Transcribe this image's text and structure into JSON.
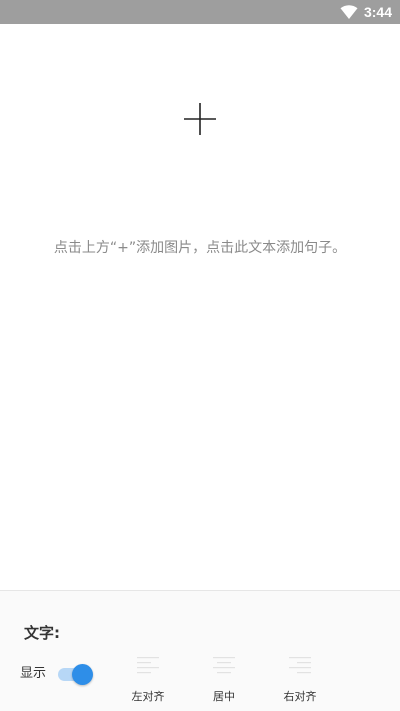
{
  "status_bar": {
    "time": "3:44",
    "wifi_icon": "wifi-icon"
  },
  "canvas": {
    "add_icon": "plus-icon",
    "hint": "点击上方“+”添加图片，点击此文本添加句子。"
  },
  "text_panel": {
    "title": "文字:",
    "show_label": "显示",
    "show_enabled": true,
    "align_options": [
      {
        "label": "左对齐",
        "icon": "align-left-icon"
      },
      {
        "label": "居中",
        "icon": "align-center-icon"
      },
      {
        "label": "右对齐",
        "icon": "align-right-icon"
      }
    ]
  },
  "colors": {
    "status_bar": "#9e9e9e",
    "toggle_on": "#2e8ee8",
    "toggle_track": "#b7d7f6",
    "hint_text": "#8a8a8a"
  }
}
